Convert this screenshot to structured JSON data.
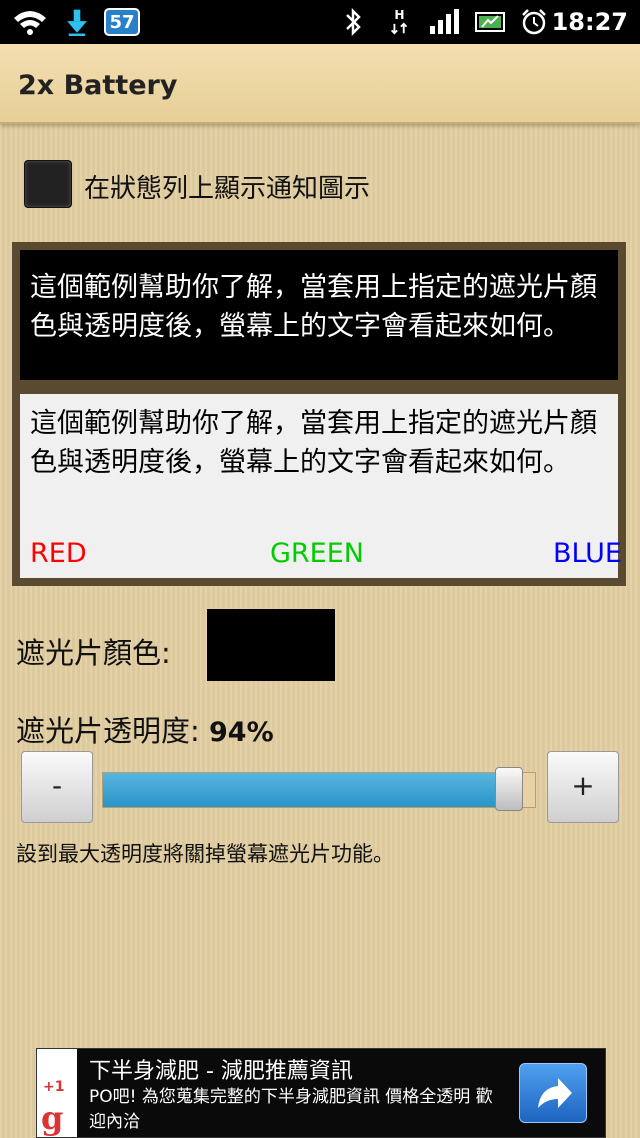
{
  "status_bar": {
    "time": "18:27",
    "badge": "57",
    "icons": [
      "wifi-icon",
      "download-icon",
      "bluetooth-icon",
      "network-h-icon",
      "signal-icon",
      "battery-icon",
      "alarm-icon"
    ]
  },
  "title_bar": {
    "title": "2x Battery"
  },
  "notification_checkbox": {
    "label": "在狀態列上顯示通知圖示",
    "checked": false
  },
  "preview": {
    "dark_text": "這個範例幫助你了解，當套用上指定的遮光片顏色與透明度後，螢幕上的文字會看起來如何。",
    "light_text": "這個範例幫助你了解，當套用上指定的遮光片顏色與透明度後，螢幕上的文字會看起來如何。",
    "red_label": "RED",
    "green_label": "GREEN",
    "blue_label": "BLUE"
  },
  "color": {
    "label": "遮光片顏色:",
    "swatch_color": "#000000"
  },
  "transparency": {
    "label": "遮光片透明度:",
    "value_text": "94%",
    "slider_value": 0.94,
    "minus_label": "-",
    "plus_label": "+"
  },
  "note": "設到最大透明度將關掉螢幕遮光片功能。",
  "ad": {
    "badge": "+1",
    "logo_letter": "g",
    "title": "下半身減肥 - 減肥推薦資訊",
    "description": "PO吧! 為您蒐集完整的下半身減肥資訊 價格全透明 歡迎內洽"
  },
  "colors": {
    "accent": "#2a94c8",
    "red": "#ff0000",
    "green": "#00cc00",
    "blue": "#0000ff"
  }
}
